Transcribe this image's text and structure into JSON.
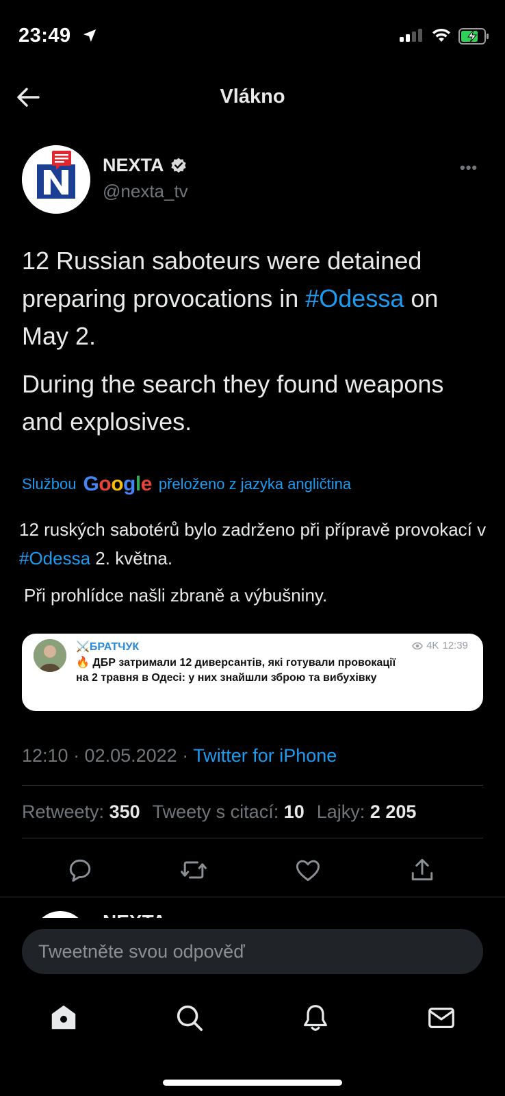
{
  "status_bar": {
    "time": "23:49"
  },
  "nav": {
    "title": "Vlákno"
  },
  "tweet": {
    "author_name": "NEXTA",
    "author_handle": "@nexta_tv",
    "text_p1_before": "12 Russian saboteurs were detained preparing provocations in ",
    "text_p1_hashtag": "#Odessa",
    "text_p1_after": " on May 2.",
    "text_p2": "During the search they found weapons and explosives.",
    "translation_prefix": "Službou",
    "translation_brand": "Google",
    "translation_suffix": "přeloženo z jazyka angličtina",
    "translated_p1_before": "12 ruských sabotérů bylo zadrženo při přípravě provokací v ",
    "translated_p1_hashtag": "#Odessa",
    "translated_p1_after": " 2. května.",
    "translated_p2": "Při prohlídce našli zbraně a výbušniny.",
    "embed": {
      "channel": "⚔️БРАТЧУК",
      "views": "4K",
      "time": "12:39",
      "text": "🔥 ДБР затримали 12 диверсантів, які готували провокації на 2 травня в Одесі: у них знайшли зброю та вибухівку"
    },
    "timestamp": "12:10 · 02.05.2022 · ",
    "source_app": "Twitter for iPhone",
    "stats": {
      "retweets_label": "Retweety:",
      "retweets": "350",
      "quotes_label": "Tweety s citací:",
      "quotes": "10",
      "likes_label": "Lajky:",
      "likes": "2 205"
    }
  },
  "next_tweet_peek": {
    "author_name": "NEXTA"
  },
  "reply": {
    "placeholder": "Tweetněte svou odpověď"
  },
  "colors": {
    "accent": "#1d9bf0",
    "background": "#000000",
    "muted": "#71767b"
  },
  "icons": [
    "location-arrow-icon",
    "signal-icon",
    "wifi-icon",
    "battery-icon",
    "back-arrow-icon",
    "verified-badge-icon",
    "more-icon",
    "eye-icon",
    "reply-icon",
    "retweet-icon",
    "like-icon",
    "share-icon",
    "home-icon",
    "search-icon",
    "notifications-icon",
    "messages-icon"
  ]
}
